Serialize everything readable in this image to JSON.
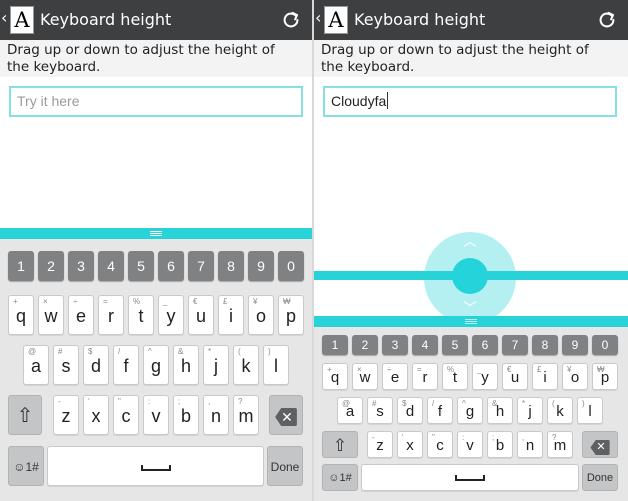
{
  "app": {
    "title": "Keyboard height",
    "instruction": "Drag up or down to adjust the height of the keyboard."
  },
  "left_panel": {
    "input_placeholder": "Try it here"
  },
  "right_panel": {
    "input_value": "Cloudyfa"
  },
  "keyboard": {
    "numbers": [
      "1",
      "2",
      "3",
      "4",
      "5",
      "6",
      "7",
      "8",
      "9",
      "0"
    ],
    "row1": [
      {
        "main": "q",
        "sec": "+"
      },
      {
        "main": "w",
        "sec": "×"
      },
      {
        "main": "e",
        "sec": "÷"
      },
      {
        "main": "r",
        "sec": "="
      },
      {
        "main": "t",
        "sec": "%"
      },
      {
        "main": "y",
        "sec": "_"
      },
      {
        "main": "u",
        "sec": "€"
      },
      {
        "main": "i",
        "sec": "£"
      },
      {
        "main": "o",
        "sec": "¥"
      },
      {
        "main": "p",
        "sec": "₩"
      }
    ],
    "row2": [
      {
        "main": "a",
        "sec": "@"
      },
      {
        "main": "s",
        "sec": "#"
      },
      {
        "main": "d",
        "sec": "$"
      },
      {
        "main": "f",
        "sec": "/"
      },
      {
        "main": "g",
        "sec": "^"
      },
      {
        "main": "h",
        "sec": "&"
      },
      {
        "main": "j",
        "sec": "*"
      },
      {
        "main": "k",
        "sec": "("
      },
      {
        "main": "l",
        "sec": ")"
      }
    ],
    "row3": [
      {
        "main": "z",
        "sec": "-"
      },
      {
        "main": "x",
        "sec": "'"
      },
      {
        "main": "c",
        "sec": "\""
      },
      {
        "main": "v",
        "sec": ":"
      },
      {
        "main": "b",
        "sec": ";"
      },
      {
        "main": "n",
        "sec": ","
      },
      {
        "main": "m",
        "sec": "?"
      }
    ],
    "symbol_key": "☺1#",
    "done_label": "Done"
  },
  "colors": {
    "accent": "#28d3d8",
    "titlebar": "#3d3f41",
    "number_key": "#7f8183",
    "keyboard_bg": "#e6e6e6"
  },
  "icons": [
    "back-arrow-icon",
    "app-font-icon",
    "reset-icon",
    "drag-handle-icon",
    "shift-icon",
    "backspace-icon",
    "space-icon",
    "chevron-up-icon",
    "chevron-down-icon"
  ]
}
